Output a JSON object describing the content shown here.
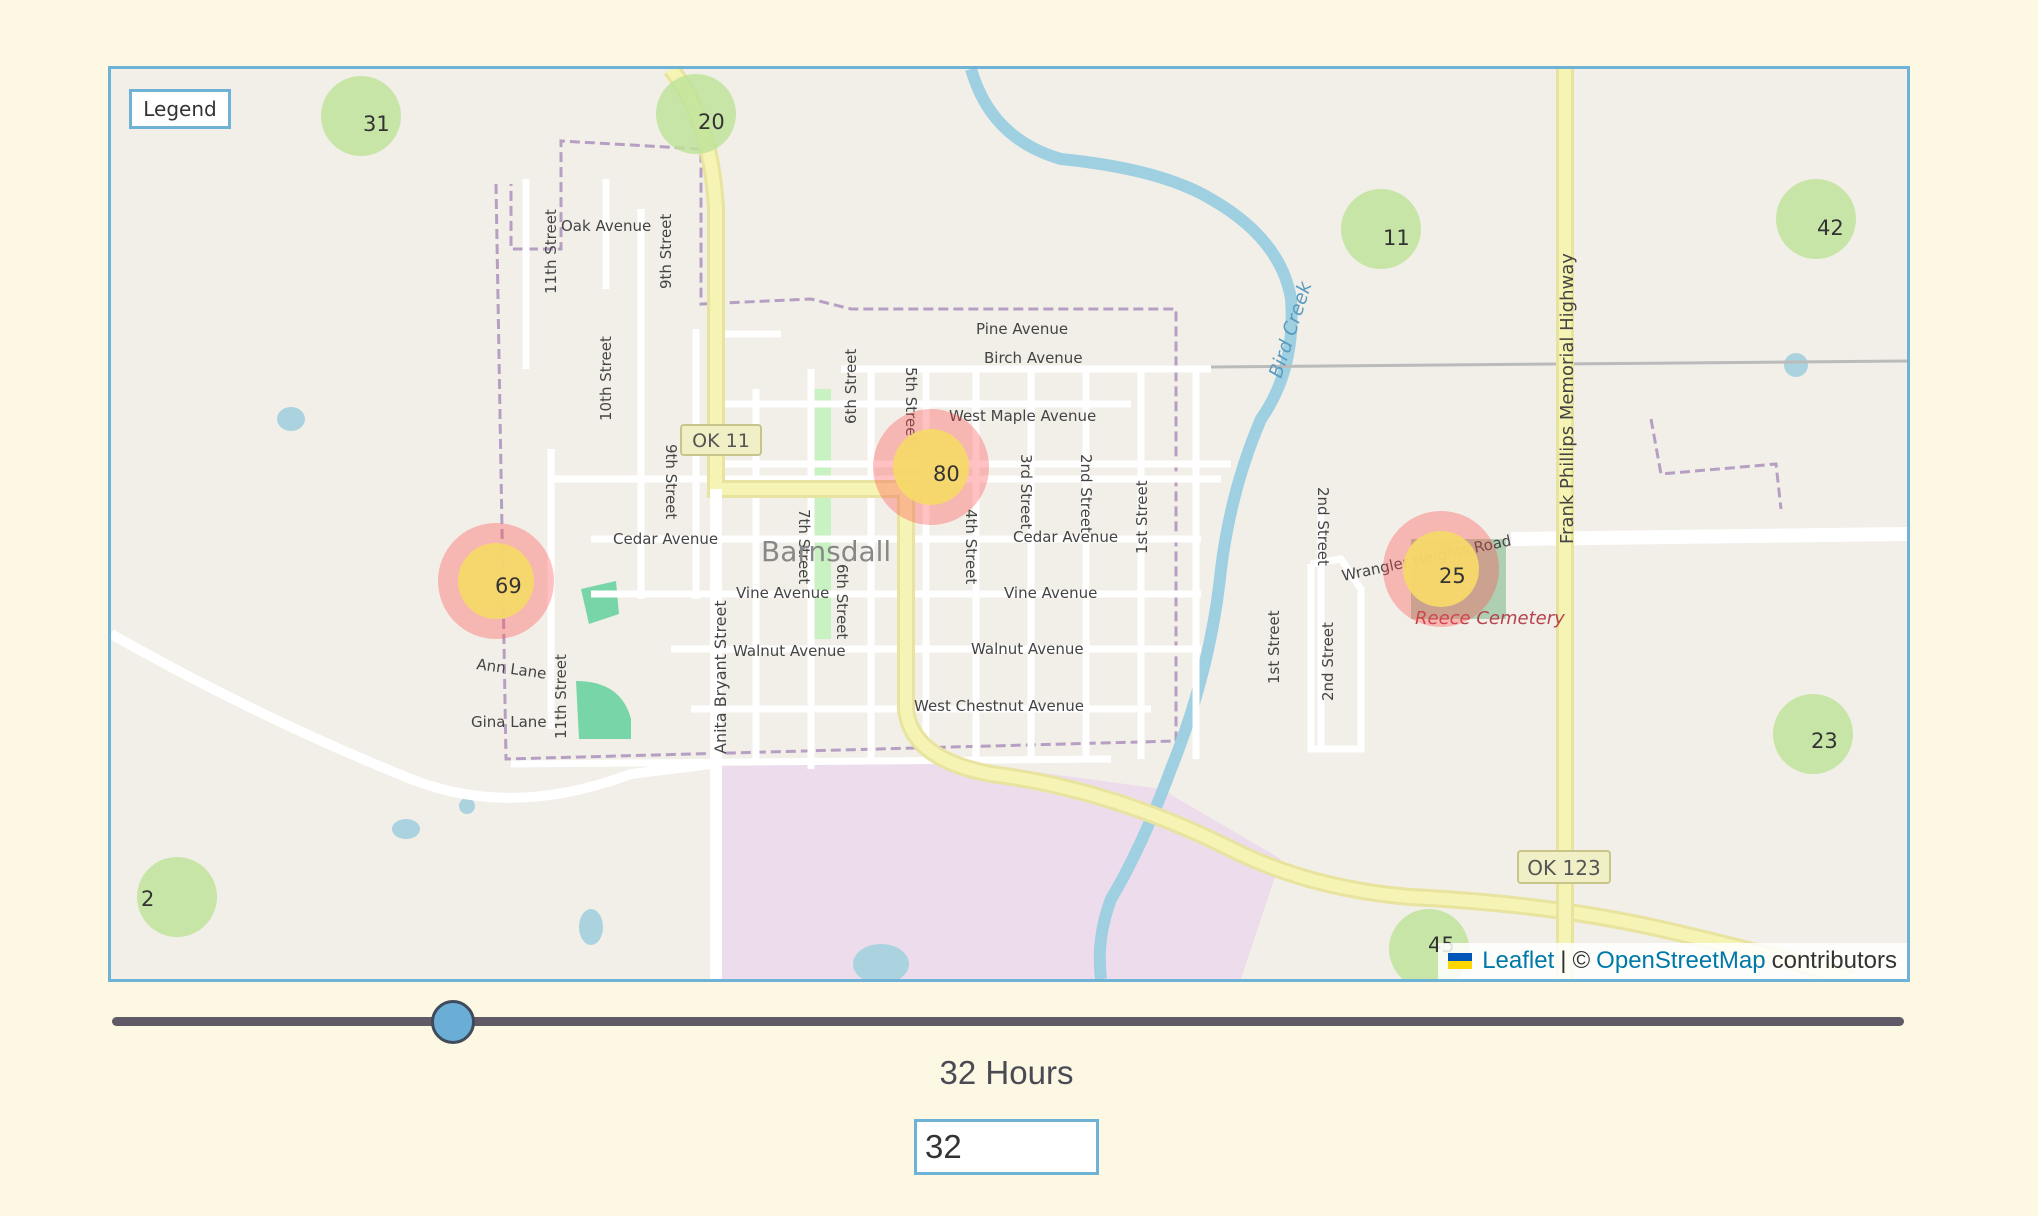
{
  "legend": {
    "label": "Legend"
  },
  "map": {
    "town_label": "Barnsdall",
    "streets": [
      "Oak Avenue",
      "11th Street",
      "9th Street",
      "Pine Avenue",
      "Birch Avenue",
      "10th Street",
      "West Maple Avenue",
      "OK 11",
      "5th Street",
      "6th Street",
      "3rd Street",
      "2nd Street",
      "9th Street",
      "Cedar Avenue",
      "Cedar Avenue",
      "7th Street",
      "4th Street",
      "1st Street",
      "Vine Avenue",
      "Vine Avenue",
      "Walnut Avenue",
      "Walnut Avenue",
      "West Chestnut Avenue",
      "Ann Lane",
      "Gina Lane",
      "11th Street",
      "Anita Bryant Street",
      "6th Street",
      "Bird Creek",
      "Frank Phillips Memorial Highway",
      "Wrangler Heights Road",
      "Reece Cemetery",
      "2nd Street",
      "1st Street",
      "2nd Street",
      "OK 123"
    ],
    "counts": [
      "31",
      "20",
      "11",
      "42",
      "80",
      "69",
      "25",
      "23",
      "2",
      "45"
    ],
    "hot_sites": [
      {
        "value": 80,
        "color": "#f5cf3f"
      },
      {
        "value": 69,
        "color": "#f5cf3f"
      },
      {
        "value": 25,
        "color": "#f5cf3f"
      }
    ],
    "cool_color": "#bfe39a",
    "glow_color": "#ff4d4d"
  },
  "attribution": {
    "leaflet": "Leaflet",
    "separator": "|",
    "copyright": "©",
    "osm": "OpenStreetMap",
    "suffix": "contributors"
  },
  "slider": {
    "min": 0,
    "max": 168,
    "value": 32
  },
  "hours": {
    "label": "32 Hours",
    "value": "32"
  }
}
